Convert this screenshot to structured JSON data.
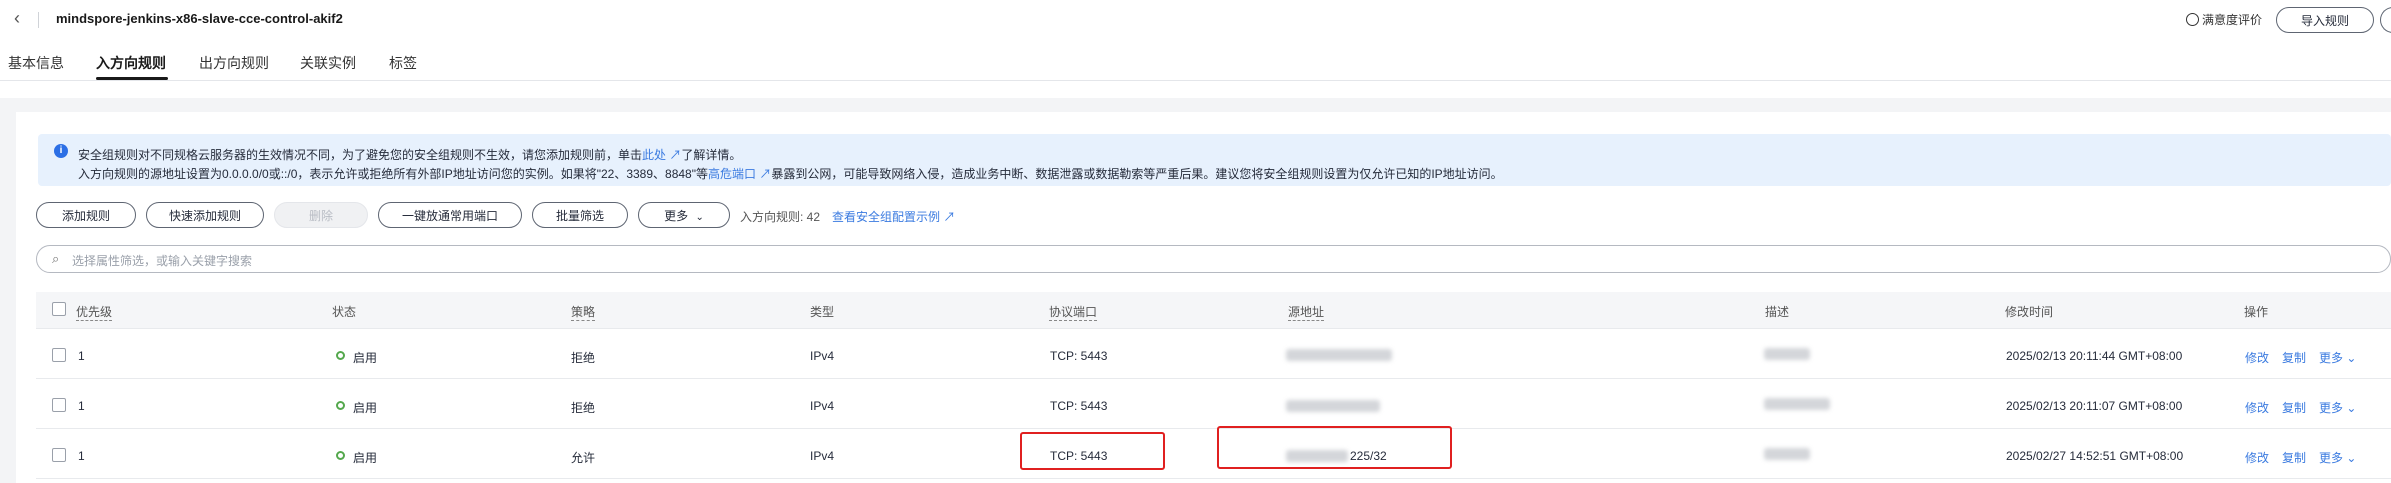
{
  "header": {
    "back_icon": "chevron-left-icon",
    "title": "mindspore-jenkins-x86-slave-cce-control-akif2",
    "satisfaction": "满意度评价",
    "import_rules": "导入规则"
  },
  "tabs": [
    {
      "label": "基本信息"
    },
    {
      "label": "入方向规则",
      "active": true
    },
    {
      "label": "出方向规则"
    },
    {
      "label": "关联实例"
    },
    {
      "label": "标签"
    }
  ],
  "notice": {
    "icon": "info-icon",
    "line1_prefix": "安全组规则对不同规格云服务器的生效情况不同，为了避免您的安全组规则不生效，请您添加规则前，单击",
    "line1_link": "此处",
    "line1_suffix": "了解详情。",
    "line2_prefix": "入方向规则的源地址设置为0.0.0.0/0或::/0，表示允许或拒绝所有外部IP地址访问您的实例。如果将\"22、3389、8848\"等",
    "line2_link": "高危端口",
    "line2_suffix": "暴露到公网，可能导致网络入侵，造成业务中断、数据泄露或数据勒索等严重后果。建议您将安全组规则设置为仅允许已知的IP地址访问。"
  },
  "toolbar": {
    "add_rule": "添加规则",
    "quick_add": "快速添加规则",
    "delete": "删除",
    "open_common_ports": "一键放通常用端口",
    "batch_filter": "批量筛选",
    "more": "更多",
    "rule_count": "入方向规则: 42",
    "example_link": "查看安全组配置示例"
  },
  "search": {
    "placeholder": "选择属性筛选，或输入关键字搜索"
  },
  "table": {
    "columns": [
      "优先级",
      "状态",
      "策略",
      "类型",
      "协议端口",
      "源地址",
      "描述",
      "修改时间",
      "操作"
    ],
    "rows": [
      {
        "priority": "1",
        "status": "启用",
        "policy": "拒绝",
        "type": "IPv4",
        "port": "TCP: 5443",
        "source": "",
        "desc": "",
        "time": "2025/02/13 20:11:44 GMT+08:00",
        "ops": [
          "修改",
          "复制",
          "更多"
        ]
      },
      {
        "priority": "1",
        "status": "启用",
        "policy": "拒绝",
        "type": "IPv4",
        "port": "TCP: 5443",
        "source": "",
        "desc": "",
        "time": "2025/02/13 20:11:07 GMT+08:00",
        "ops": [
          "修改",
          "复制",
          "更多"
        ]
      },
      {
        "priority": "1",
        "status": "启用",
        "policy": "允许",
        "type": "IPv4",
        "port": "TCP: 5443",
        "source": "225/32",
        "desc": "",
        "time": "2025/02/27 14:52:51 GMT+08:00",
        "ops": [
          "修改",
          "复制",
          "更多"
        ]
      }
    ]
  },
  "colors": {
    "accent": "#3b7be0",
    "enabled": "#54a84d",
    "highlight": "#e02020"
  }
}
